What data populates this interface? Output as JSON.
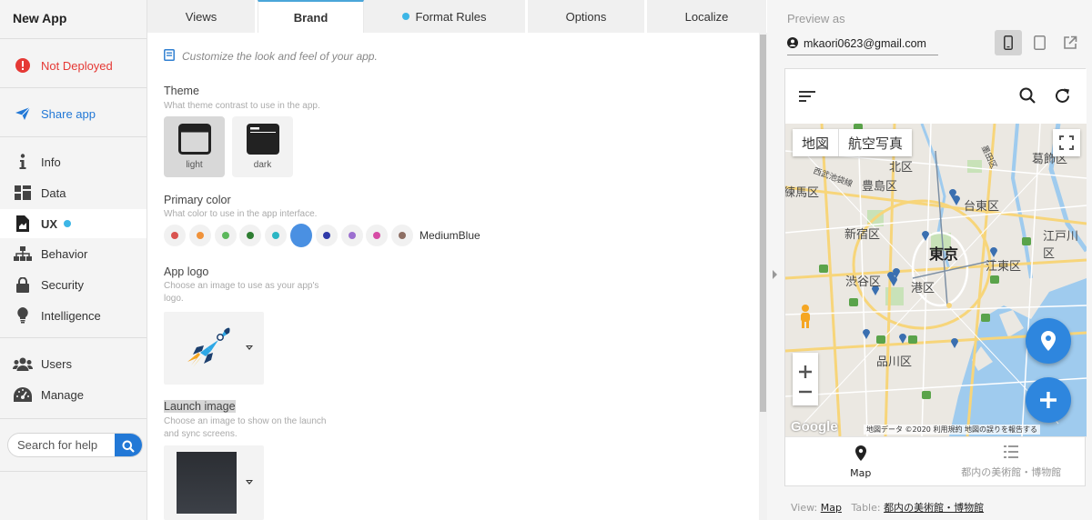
{
  "app": {
    "title": "New App"
  },
  "sidebar": {
    "status": "Not Deployed",
    "share": "Share app",
    "items": [
      {
        "label": "Info"
      },
      {
        "label": "Data"
      },
      {
        "label": "UX"
      },
      {
        "label": "Behavior"
      },
      {
        "label": "Security"
      },
      {
        "label": "Intelligence"
      },
      {
        "label": "Users"
      },
      {
        "label": "Manage"
      }
    ],
    "search_placeholder": "Search for help"
  },
  "tabs": [
    {
      "label": "Views"
    },
    {
      "label": "Brand"
    },
    {
      "label": "Format Rules"
    },
    {
      "label": "Options"
    },
    {
      "label": "Localize"
    }
  ],
  "brand": {
    "hint": "Customize the look and feel of your app.",
    "theme": {
      "title": "Theme",
      "desc": "What theme contrast to use in the app.",
      "options": [
        "light",
        "dark"
      ],
      "selected": "light"
    },
    "primary_color": {
      "title": "Primary color",
      "desc": "What color to use in the app interface.",
      "swatches": [
        "#d9534f",
        "#f0923a",
        "#5cb85c",
        "#2e7d32",
        "#2bb6c4",
        "#4a90e2",
        "#2f3aa8",
        "#9c6fd0",
        "#d64ca5",
        "#8d6e63"
      ],
      "selected_color": "MediumBlue"
    },
    "app_logo": {
      "title": "App logo",
      "desc": "Choose an image to use as your app's logo."
    },
    "launch_image": {
      "title": "Launch image",
      "desc": "Choose an image to show on the launch and sync screens."
    }
  },
  "preview": {
    "label": "Preview as",
    "user": "mkaori0623@gmail.com",
    "map_tabs": [
      "地図",
      "航空写真"
    ],
    "map_labels": {
      "toshima": "豊島区",
      "kita": "北区",
      "katsushika": "葛飾区",
      "nerima": "練馬区",
      "taito": "台東区",
      "shinjuku": "新宿区",
      "edogawa": "江戸川区",
      "tokyo": "東京",
      "shibuya": "渋谷区",
      "koto": "江東区",
      "minato": "港区",
      "shinagawa": "品川区",
      "nishitokyo": "西武池袋線",
      "sumida": "墨田区"
    },
    "map_attribution": "地図データ ©2020 利用規約 地図の誤りを報告する",
    "google": "Google",
    "nav": [
      {
        "label": "Map"
      },
      {
        "label": "都内の美術館・博物館"
      }
    ],
    "view_prefix": "View:",
    "view_name": "Map",
    "table_prefix": "Table:",
    "table_name": "都内の美術館・博物館"
  }
}
